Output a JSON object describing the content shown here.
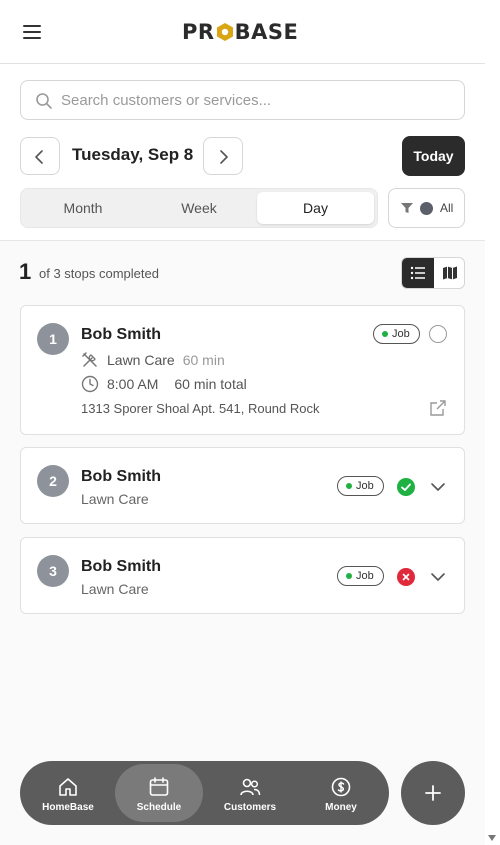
{
  "header": {
    "logo_text_left": "PR",
    "logo_text_right": "BASE",
    "menu_icon": "hamburger-icon"
  },
  "search": {
    "placeholder": "Search customers or services..."
  },
  "date_nav": {
    "title": "Tuesday, Sep 8",
    "today_label": "Today"
  },
  "view_toggle": {
    "options": [
      "Month",
      "Week",
      "Day"
    ],
    "selected": "Day"
  },
  "filter": {
    "label": "All"
  },
  "progress": {
    "completed": "1",
    "text": "of 3 stops completed"
  },
  "layout_toggle": {
    "selected": "list"
  },
  "stops": [
    {
      "number": "1",
      "name": "Bob Smith",
      "service": "Lawn Care",
      "duration": "60 min",
      "time": "8:00 AM",
      "total": "60 min total",
      "address": "1313 Sporer Shoal Apt. 541, Round Rock",
      "badge": "Job",
      "status": "pending",
      "expanded": true
    },
    {
      "number": "2",
      "name": "Bob Smith",
      "service": "Lawn Care",
      "badge": "Job",
      "status": "completed",
      "expanded": false
    },
    {
      "number": "3",
      "name": "Bob Smith",
      "service": "Lawn Care",
      "badge": "Job",
      "status": "cancelled",
      "expanded": false
    }
  ],
  "bottom_nav": {
    "items": [
      {
        "label": "HomeBase",
        "icon": "home-icon"
      },
      {
        "label": "Schedule",
        "icon": "calendar-icon"
      },
      {
        "label": "Customers",
        "icon": "users-icon"
      },
      {
        "label": "Money",
        "icon": "dollar-icon"
      }
    ],
    "active": "Schedule"
  },
  "colors": {
    "dark": "#2b2b2b",
    "accent_gold": "#d9a514",
    "success": "#1fb141",
    "danger": "#e0293a",
    "nav_bg": "#5c5c5c",
    "badge_gray": "#8e939b"
  }
}
